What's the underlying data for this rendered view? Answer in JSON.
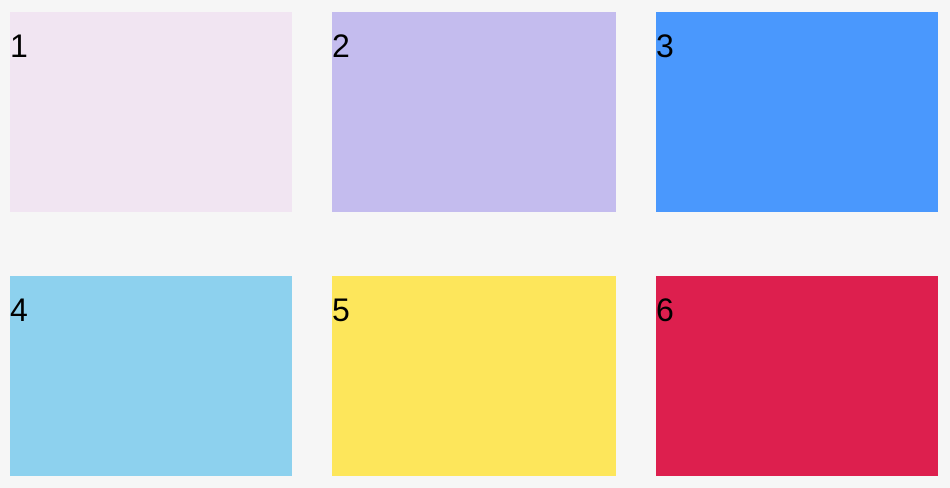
{
  "boxes": [
    {
      "label": "1",
      "color": "#f1e5f2"
    },
    {
      "label": "2",
      "color": "#c4bcee"
    },
    {
      "label": "3",
      "color": "#4a98fd"
    },
    {
      "label": "4",
      "color": "#8dd1ee"
    },
    {
      "label": "5",
      "color": "#fde65b"
    },
    {
      "label": "6",
      "color": "#dd1f4e"
    }
  ]
}
